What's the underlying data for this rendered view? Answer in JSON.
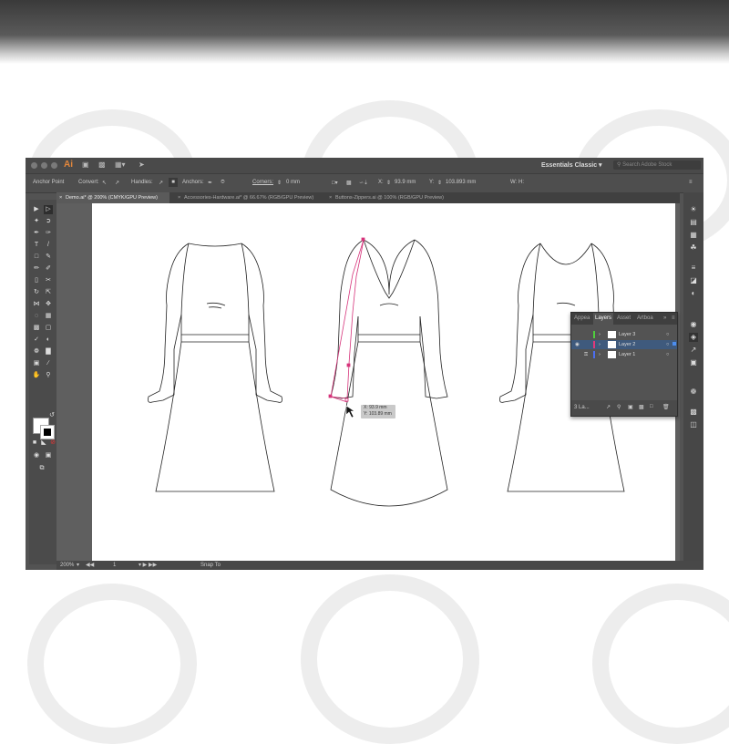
{
  "workspace": "Essentials Classic",
  "search_placeholder": "Search Adobe Stock",
  "control": {
    "mode": "Anchor Point",
    "convert": "Convert:",
    "handles": "Handles:",
    "anchors": "Anchors:",
    "corners": "Corners:",
    "corners_value": "0 mm",
    "x_label": "X:",
    "x_value": "93.9 mm",
    "y_label": "Y:",
    "y_value": "103.893 mm",
    "w_label": "W:",
    "h_label": "H:"
  },
  "tabs": [
    {
      "label": "Demo.ai* @ 200% (CMYK/GPU Preview)",
      "active": true
    },
    {
      "label": "Accessories-Hardware.ai* @ 66.67% (RGB/GPU Preview)",
      "active": false
    },
    {
      "label": "Buttons-Zippers.ai @ 100% (RGB/GPU Preview)",
      "active": false
    }
  ],
  "layers_panel": {
    "tabs": [
      "Appea",
      "Layers",
      "Asset",
      "Artboa"
    ],
    "active_tab": "Layers",
    "layers": [
      {
        "name": "Layer 3",
        "color": "#4fcf3d",
        "selected": false,
        "visible": false,
        "locked": false
      },
      {
        "name": "Layer 2",
        "color": "#e3387a",
        "selected": true,
        "visible": true,
        "locked": false
      },
      {
        "name": "Layer 1",
        "color": "#4c6ef0",
        "selected": false,
        "visible": false,
        "locked": true
      }
    ],
    "count": "3 La..."
  },
  "tooltip": {
    "x": "X: 93.9 mm",
    "y": "Y: 103.89 mm"
  },
  "status": {
    "zoom": "200%",
    "artboard": "1",
    "snap": "Snap To"
  },
  "colors": {
    "path_highlight": "#d6337a",
    "ui_bg": "#535353"
  }
}
